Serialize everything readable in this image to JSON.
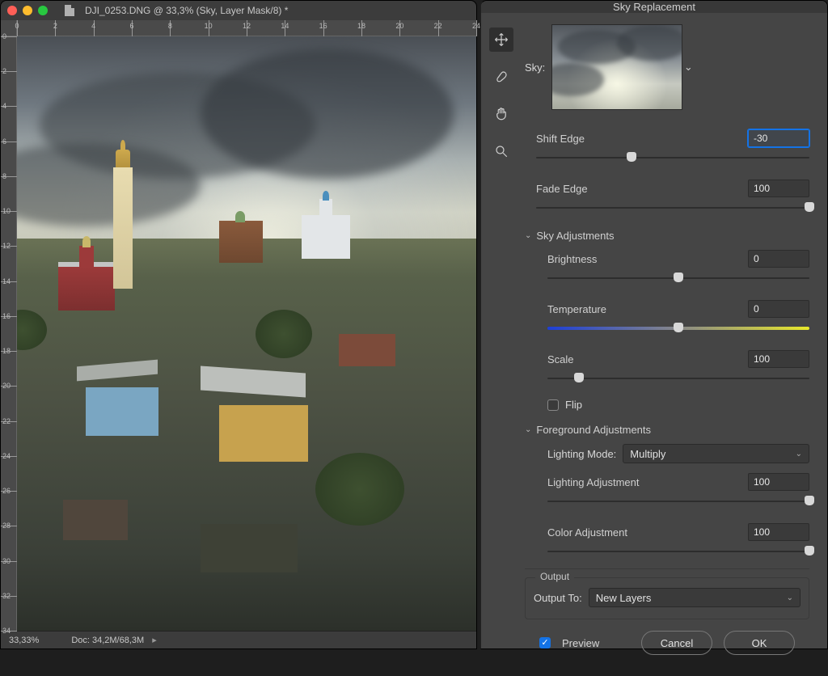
{
  "doc": {
    "title": "DJI_0253.DNG @ 33,3% (Sky, Layer Mask/8) *",
    "ruler_h": [
      "0",
      "2",
      "4",
      "6",
      "8",
      "10",
      "12",
      "14",
      "16",
      "18",
      "20",
      "22",
      "24"
    ],
    "ruler_v": [
      "0",
      "2",
      "4",
      "6",
      "8",
      "10",
      "12",
      "14",
      "16",
      "18",
      "20",
      "22",
      "24",
      "26",
      "28",
      "30",
      "32",
      "34"
    ],
    "status_zoom": "33,33%",
    "status_doc": "Doc: 34,2M/68,3M"
  },
  "dialog": {
    "title": "Sky Replacement",
    "tools": [
      "move-tool",
      "brush-tool",
      "hand-tool",
      "zoom-tool"
    ],
    "sky_label": "Sky:",
    "sliders": {
      "shift_edge": {
        "label": "Shift Edge",
        "value": "-30",
        "pos": 35,
        "focused": true
      },
      "fade_edge": {
        "label": "Fade Edge",
        "value": "100",
        "pos": 100
      },
      "brightness": {
        "label": "Brightness",
        "value": "0",
        "pos": 50
      },
      "temperature": {
        "label": "Temperature",
        "value": "0",
        "pos": 50
      },
      "scale": {
        "label": "Scale",
        "value": "100",
        "pos": 12
      },
      "light_adj": {
        "label": "Lighting Adjustment",
        "value": "100",
        "pos": 100
      },
      "color_adj": {
        "label": "Color Adjustment",
        "value": "100",
        "pos": 100
      }
    },
    "sections": {
      "sky_adj": "Sky Adjustments",
      "fg_adj": "Foreground Adjustments"
    },
    "flip_label": "Flip",
    "flip_checked": false,
    "lighting_mode_label": "Lighting Mode:",
    "lighting_mode_value": "Multiply",
    "output_legend": "Output",
    "output_to_label": "Output To:",
    "output_to_value": "New Layers",
    "preview_label": "Preview",
    "preview_checked": true,
    "buttons": {
      "cancel": "Cancel",
      "ok": "OK"
    }
  }
}
